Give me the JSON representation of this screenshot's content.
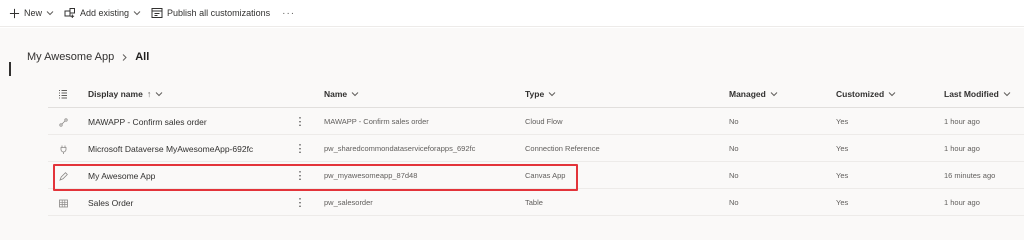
{
  "toolbar": {
    "new_label": "New",
    "add_existing_label": "Add existing",
    "publish_label": "Publish all customizations",
    "more_label": "···"
  },
  "breadcrumb": {
    "parent": "My Awesome App",
    "current": "All"
  },
  "columns": {
    "display_name": "Display name",
    "sort_arrow": "↑",
    "name": "Name",
    "type": "Type",
    "managed": "Managed",
    "customized": "Customized",
    "last_modified": "Last Modified"
  },
  "rows": [
    {
      "icon": "flow-icon",
      "display_name": "MAWAPP - Confirm sales order",
      "name": "MAWAPP - Confirm sales order",
      "type": "Cloud Flow",
      "managed": "No",
      "customized": "Yes",
      "last_modified": "1 hour ago"
    },
    {
      "icon": "plug-icon",
      "display_name": "Microsoft Dataverse MyAwesomeApp-692fc",
      "name": "pw_sharedcommondataserviceforapps_692fc",
      "type": "Connection Reference",
      "managed": "No",
      "customized": "Yes",
      "last_modified": "1 hour ago"
    },
    {
      "icon": "pencil-icon",
      "display_name": "My Awesome App",
      "name": "pw_myawesomeapp_87d48",
      "type": "Canvas App",
      "managed": "No",
      "customized": "Yes",
      "last_modified": "16 minutes ago"
    },
    {
      "icon": "table-icon",
      "display_name": "Sales Order",
      "name": "pw_salesorder",
      "type": "Table",
      "managed": "No",
      "customized": "Yes",
      "last_modified": "1 hour ago"
    }
  ],
  "row_more_label": "⋮",
  "colors": {
    "accent": "#0f6cbd",
    "highlight": "#e3343a",
    "content_background": "#faf9f8"
  }
}
